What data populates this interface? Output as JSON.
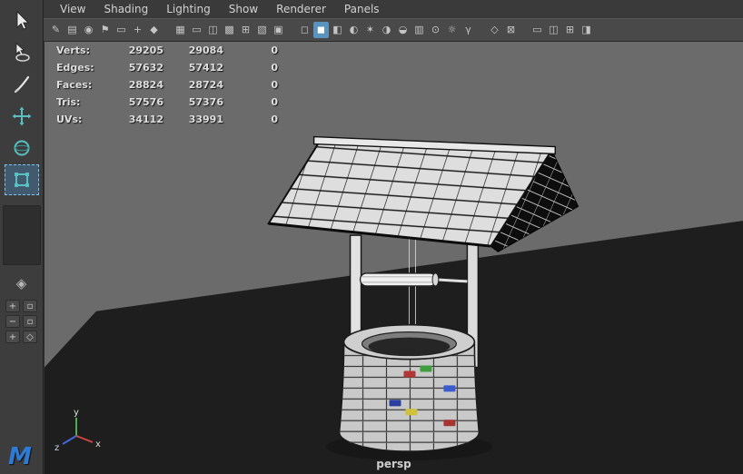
{
  "menubar": {
    "items": [
      "View",
      "Shading",
      "Lighting",
      "Show",
      "Renderer",
      "Panels"
    ]
  },
  "toolbar": {
    "icons": [
      {
        "name": "grease-pencil-icon",
        "glyph": "✎"
      },
      {
        "name": "film-strip-icon",
        "glyph": "▤"
      },
      {
        "name": "camera-select-icon",
        "glyph": "◉"
      },
      {
        "name": "bookmark-icon",
        "glyph": "⚑"
      },
      {
        "name": "image-plane-icon",
        "glyph": "▭"
      },
      {
        "name": "pan-zoom-icon",
        "glyph": "+"
      },
      {
        "name": "snap-magnet-icon",
        "glyph": "◆"
      },
      {
        "name": "grid-icon",
        "glyph": "▦"
      },
      {
        "name": "film-gate-icon",
        "glyph": "▭"
      },
      {
        "name": "resolution-gate-icon",
        "glyph": "◫"
      },
      {
        "name": "gate-mask-icon",
        "glyph": "▩"
      },
      {
        "name": "field-chart-icon",
        "glyph": "⊞"
      },
      {
        "name": "safe-action-icon",
        "glyph": "▧"
      },
      {
        "name": "safe-title-icon",
        "glyph": "▣"
      },
      {
        "name": "wireframe-mode-icon",
        "glyph": "◻"
      },
      {
        "name": "shaded-mode-icon",
        "glyph": "◼",
        "active": true
      },
      {
        "name": "textured-mode-icon",
        "glyph": "◧"
      },
      {
        "name": "default-material-icon",
        "glyph": "◐"
      },
      {
        "name": "lighting-icon",
        "glyph": "✶"
      },
      {
        "name": "shadows-icon",
        "glyph": "◑"
      },
      {
        "name": "occlusion-icon",
        "glyph": "◒"
      },
      {
        "name": "antialias-icon",
        "glyph": "▥"
      },
      {
        "name": "motion-blur-icon",
        "glyph": "⊙"
      },
      {
        "name": "exposure-icon",
        "glyph": "☼"
      },
      {
        "name": "gamma-icon",
        "glyph": "γ"
      },
      {
        "name": "isolate-select-icon",
        "glyph": "◇"
      },
      {
        "name": "xray-icon",
        "glyph": "⊠"
      },
      {
        "name": "single-pane-icon",
        "glyph": "▭"
      },
      {
        "name": "two-pane-icon",
        "glyph": "◫"
      },
      {
        "name": "four-pane-icon",
        "glyph": "⊞"
      },
      {
        "name": "outliner-pane-icon",
        "glyph": "◨"
      }
    ]
  },
  "sidebar": {
    "tool_icons": [
      "select-tool-icon",
      "lasso-tool-icon",
      "paint-select-tool-icon",
      "move-tool-icon",
      "rotate-tool-icon",
      "scale-tool-icon"
    ],
    "component_icon_glyph": "◈",
    "small_buttons": [
      {
        "name": "plus-box-button",
        "glyph": "+"
      },
      {
        "name": "box-button",
        "glyph": "▫"
      },
      {
        "name": "minus-box-button",
        "glyph": "−"
      },
      {
        "name": "box-button-2",
        "glyph": "▫"
      },
      {
        "name": "plus-diamond-button",
        "glyph": "+"
      },
      {
        "name": "diamond-button",
        "glyph": "◇"
      }
    ]
  },
  "hud": {
    "rows": [
      {
        "label": "Verts:",
        "c1": "29205",
        "c2": "29084",
        "c3": "0"
      },
      {
        "label": "Edges:",
        "c1": "57632",
        "c2": "57412",
        "c3": "0"
      },
      {
        "label": "Faces:",
        "c1": "28824",
        "c2": "28724",
        "c3": "0"
      },
      {
        "label": "Tris:",
        "c1": "57576",
        "c2": "57376",
        "c3": "0"
      },
      {
        "label": "UVs:",
        "c1": "34112",
        "c2": "33991",
        "c3": "0"
      }
    ]
  },
  "viewport": {
    "camera_label": "persp"
  },
  "axis_gizmo": {
    "x_label": "x",
    "y_label": "y",
    "z_label": "z"
  },
  "branding": {
    "logo_letter": "M"
  },
  "colors": {
    "active_highlight": "#6fb4e8",
    "x_axis": "#d04545",
    "y_axis": "#4fae4f",
    "z_axis": "#4466d9",
    "brick_red": "#b23535",
    "brick_green": "#3f9f3f",
    "brick_blue": "#3b5bd0",
    "brick_navy": "#2b3f9f",
    "brick_yellow": "#cfc23a",
    "brick_red2": "#a83333"
  }
}
